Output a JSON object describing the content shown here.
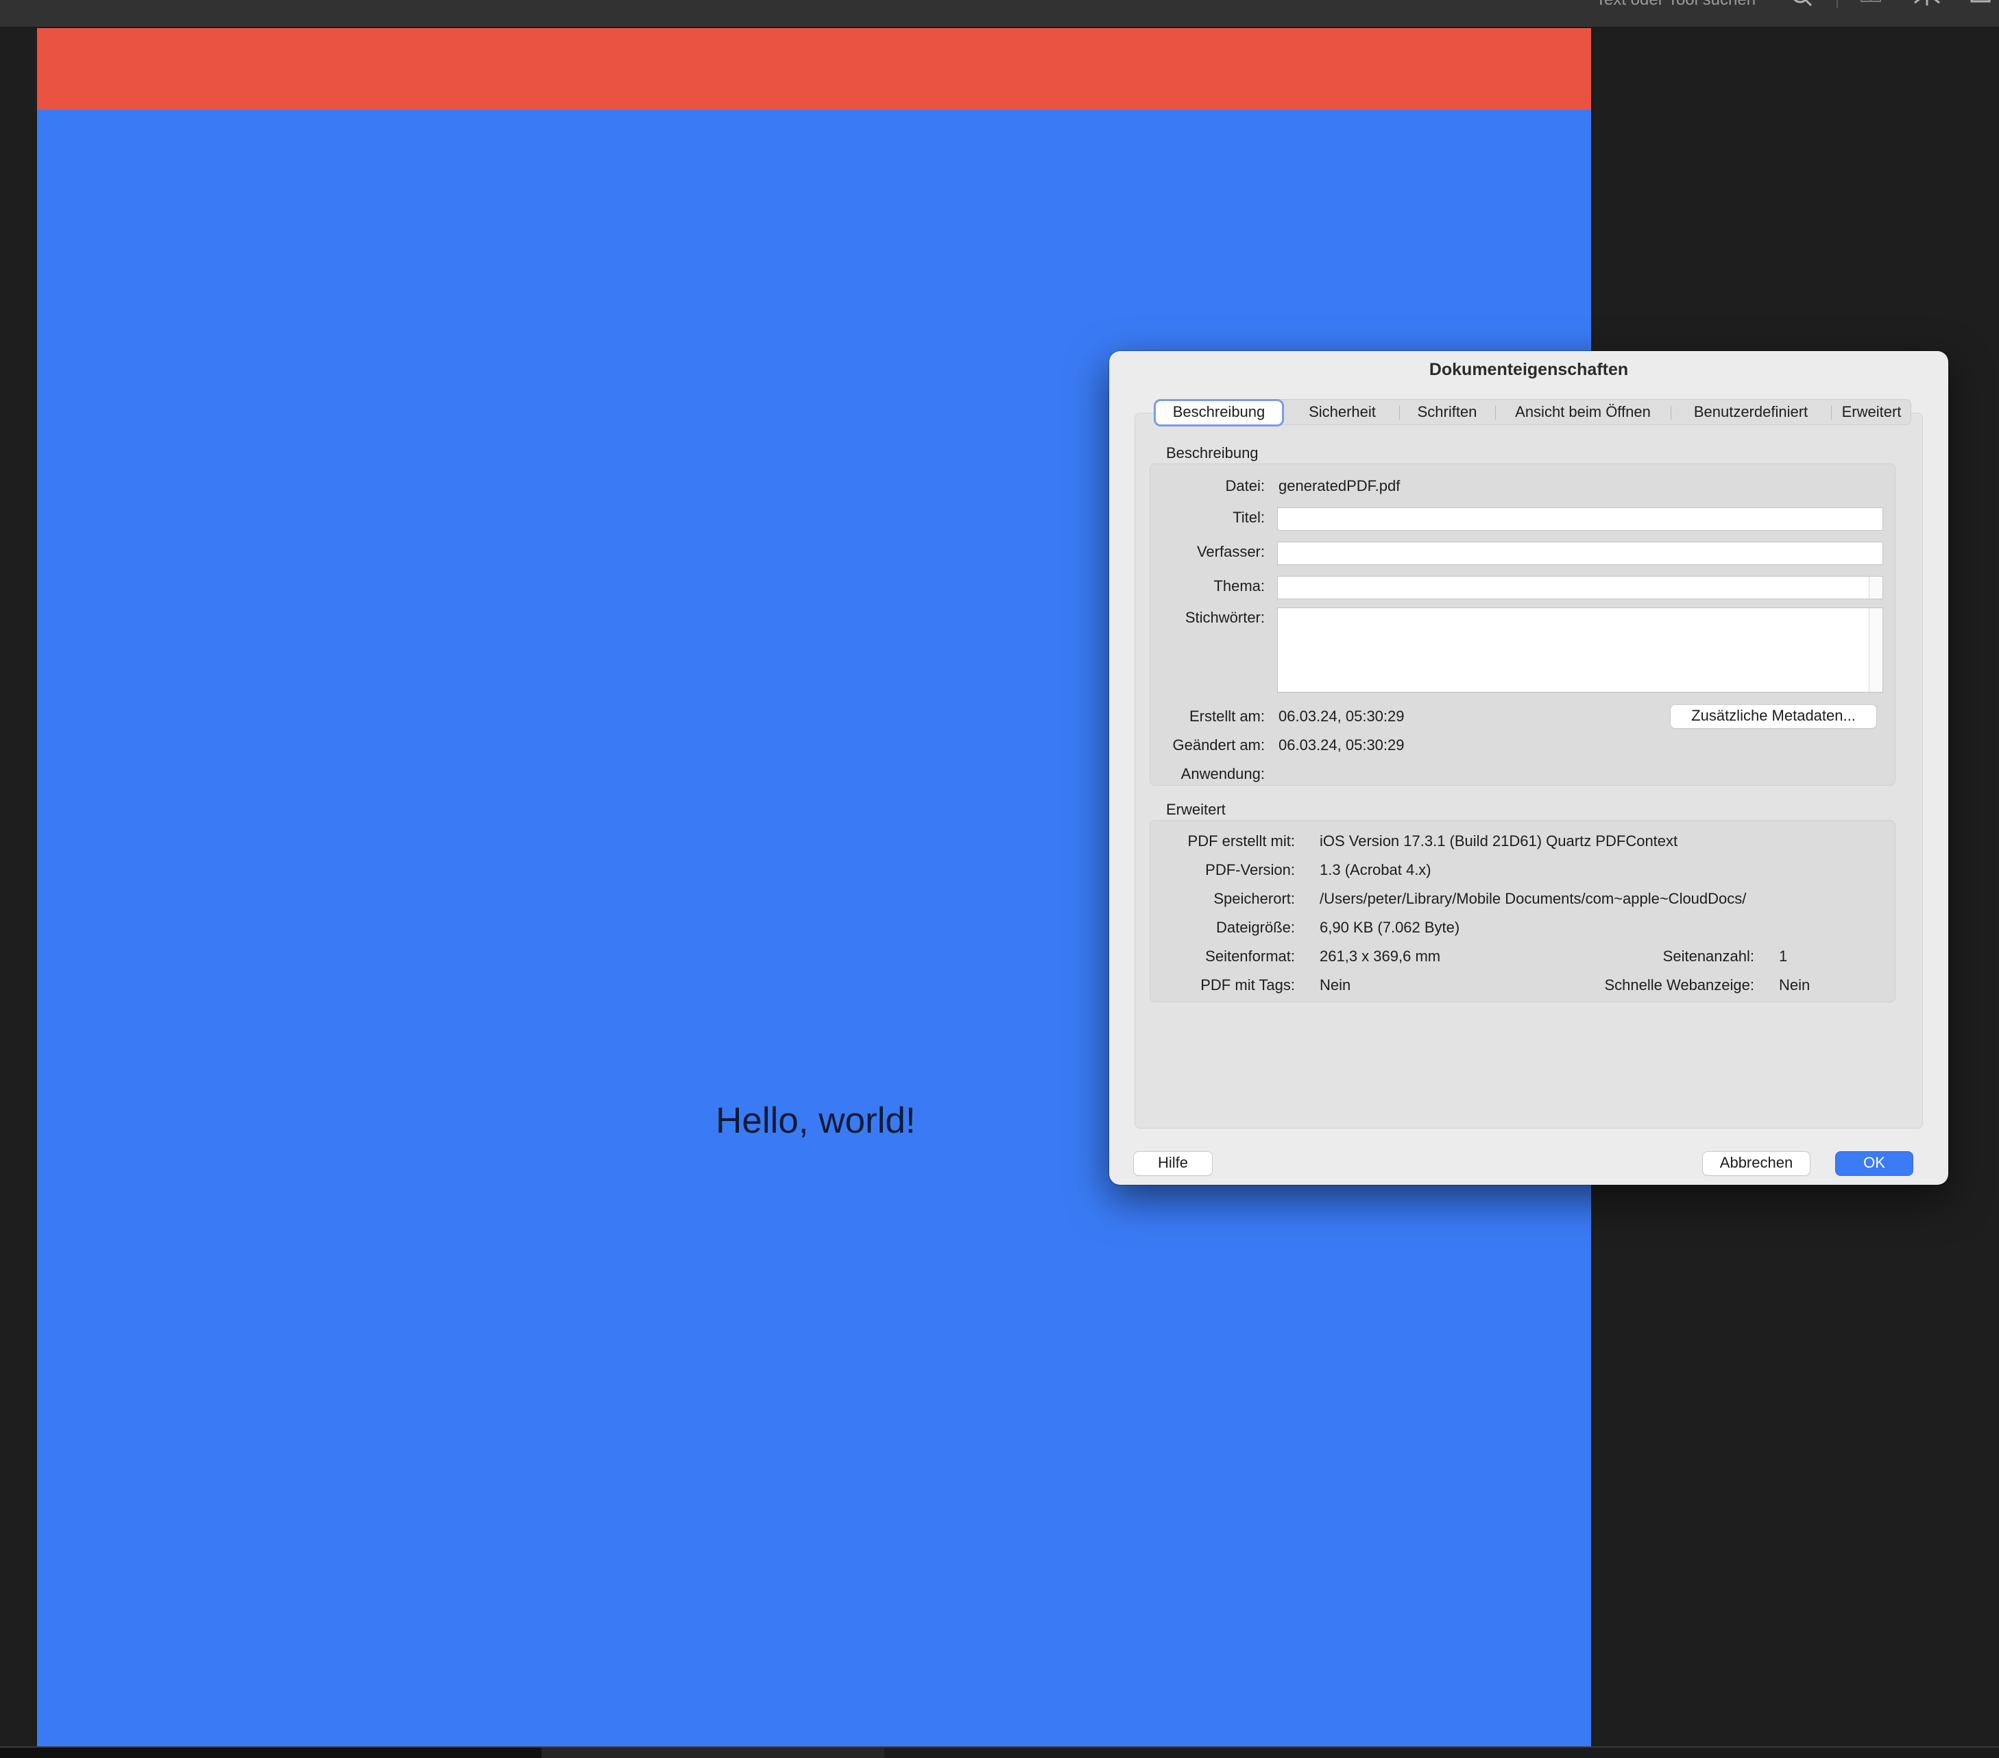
{
  "toolbar": {
    "search_text": "Text oder Tool suchen",
    "icons": [
      "search-icon",
      "grid-icon",
      "compare-icon",
      "print-icon"
    ]
  },
  "document": {
    "text": "Hello, world!",
    "header_color": "#ea5242",
    "page_color": "#3a7bf5"
  },
  "dialog": {
    "title": "Dokumenteigenschaften",
    "tabs": [
      {
        "label": "Beschreibung",
        "active": true
      },
      {
        "label": "Sicherheit"
      },
      {
        "label": "Schriften"
      },
      {
        "label": "Ansicht beim Öffnen"
      },
      {
        "label": "Benutzerdefiniert"
      },
      {
        "label": "Erweitert"
      }
    ],
    "description": {
      "section_title": "Beschreibung",
      "file_label": "Datei:",
      "file_value": "generatedPDF.pdf",
      "title_label": "Titel:",
      "title_value": "",
      "author_label": "Verfasser:",
      "author_value": "",
      "subject_label": "Thema:",
      "subject_value": "",
      "keywords_label": "Stichwörter:",
      "keywords_value": "",
      "created_label": "Erstellt am:",
      "created_value": "06.03.24, 05:30:29",
      "modified_label": "Geändert am:",
      "modified_value": "06.03.24, 05:30:29",
      "application_label": "Anwendung:",
      "application_value": "",
      "metadata_button": "Zusätzliche Metadaten..."
    },
    "advanced": {
      "section_title": "Erweitert",
      "producer_label": "PDF erstellt mit:",
      "producer_value": "iOS Version 17.3.1 (Build 21D61) Quartz PDFContext",
      "version_label": "PDF-Version:",
      "version_value": "1.3 (Acrobat 4.x)",
      "location_label": "Speicherort:",
      "location_value": "/Users/peter/Library/Mobile Documents/com~apple~CloudDocs/",
      "size_label": "Dateigröße:",
      "size_value": "6,90 KB (7.062 Byte)",
      "page_size_label": "Seitenformat:",
      "page_size_value": "261,3 x 369,6 mm",
      "page_count_label": "Seitenanzahl:",
      "page_count_value": "1",
      "tagged_label": "PDF mit Tags:",
      "tagged_value": "Nein",
      "fast_web_label": "Schnelle Webanzeige:",
      "fast_web_value": "Nein"
    },
    "buttons": {
      "help": "Hilfe",
      "cancel": "Abbrechen",
      "ok": "OK"
    }
  }
}
